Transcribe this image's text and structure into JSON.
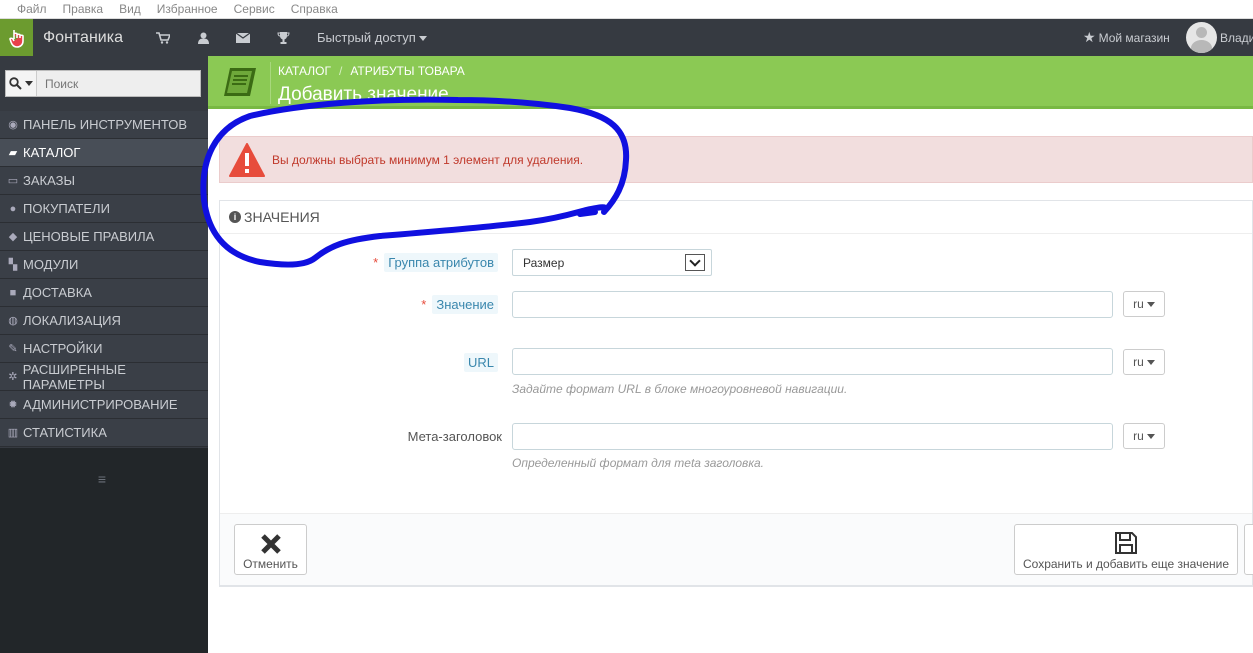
{
  "browser_menu": [
    "Файл",
    "Правка",
    "Вид",
    "Избранное",
    "Сервис",
    "Справка"
  ],
  "header": {
    "shop_name": "Фонтаника",
    "quick_access": "Быстрый доступ",
    "my_shop": "Мой магазин",
    "user_name": "Влади"
  },
  "search": {
    "placeholder": "Поиск"
  },
  "sidebar": {
    "items": [
      {
        "label": "ПАНЕЛЬ ИНСТРУМЕНТОВ",
        "icon": "dashboard-icon"
      },
      {
        "label": "КАТАЛОГ",
        "icon": "book-icon",
        "active": true
      },
      {
        "label": "ЗАКАЗЫ",
        "icon": "credit-card-icon"
      },
      {
        "label": "ПОКУПАТЕЛИ",
        "icon": "users-icon"
      },
      {
        "label": "ЦЕНОВЫЕ ПРАВИЛА",
        "icon": "tags-icon"
      },
      {
        "label": "МОДУЛИ",
        "icon": "puzzle-icon"
      },
      {
        "label": "ДОСТАВКА",
        "icon": "truck-icon"
      },
      {
        "label": "ЛОКАЛИЗАЦИЯ",
        "icon": "globe-icon"
      },
      {
        "label": "НАСТРОЙКИ",
        "icon": "wrench-icon"
      },
      {
        "label": "РАСШИРЕННЫЕ ПАРАМЕТРЫ",
        "icon": "cogs-icon"
      },
      {
        "label": "АДМИНИСТРИРОВАНИЕ",
        "icon": "cog-icon"
      },
      {
        "label": "СТАТИСТИКА",
        "icon": "bar-chart-icon"
      }
    ]
  },
  "page": {
    "breadcrumb": [
      "КАТАЛОГ",
      "АТРИБУТЫ ТОВАРА"
    ],
    "title": "Добавить значение"
  },
  "alert": {
    "message": "Вы должны выбрать минимум 1 элемент для удаления."
  },
  "panel": {
    "title": "ЗНАЧЕНИЯ",
    "fields": {
      "group_label": "Группа атрибутов",
      "group_value": "Размер",
      "value_label": "Значение",
      "value_value": "",
      "url_label": "URL",
      "url_value": "",
      "url_help": "Задайте формат URL в блоке многоуровневой навигации.",
      "meta_label": "Мета-заголовок",
      "meta_value": "",
      "meta_help": "Определенный формат для meta заголовка.",
      "lang": "ru"
    },
    "buttons": {
      "cancel": "Отменить",
      "save_add": "Сохранить и добавить еще значение"
    }
  },
  "colors": {
    "header_bg": "#363a41",
    "page_head_bg": "#8bc954",
    "alert_bg": "#f2dede",
    "alert_text": "#c0392b",
    "annotation": "#1010e0"
  }
}
